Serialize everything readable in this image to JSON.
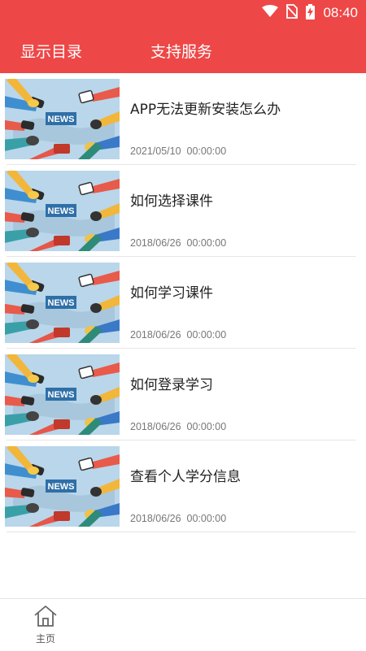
{
  "status_bar": {
    "time": "08:40",
    "icons": [
      "wifi-icon",
      "no-sim-icon",
      "battery-charging-icon"
    ]
  },
  "header": {
    "tab_catalog": "显示目录",
    "tab_support": "支持服务"
  },
  "articles": [
    {
      "title": "APP无法更新安装怎么办",
      "date": "2021/05/10  00:00:00",
      "thumbnail_text": "NEWS"
    },
    {
      "title": "如何选择课件",
      "date": "2018/06/26  00:00:00",
      "thumbnail_text": "NEWS"
    },
    {
      "title": "如何学习课件",
      "date": "2018/06/26  00:00:00",
      "thumbnail_text": "NEWS"
    },
    {
      "title": "如何登录学习",
      "date": "2018/06/26  00:00:00",
      "thumbnail_text": "NEWS"
    },
    {
      "title": "查看个人学分信息",
      "date": "2018/06/26  00:00:00",
      "thumbnail_text": "NEWS"
    }
  ],
  "bottom_nav": {
    "home_label": "主页",
    "home_icon": "home-icon"
  },
  "colors": {
    "accent": "#ee4747"
  }
}
